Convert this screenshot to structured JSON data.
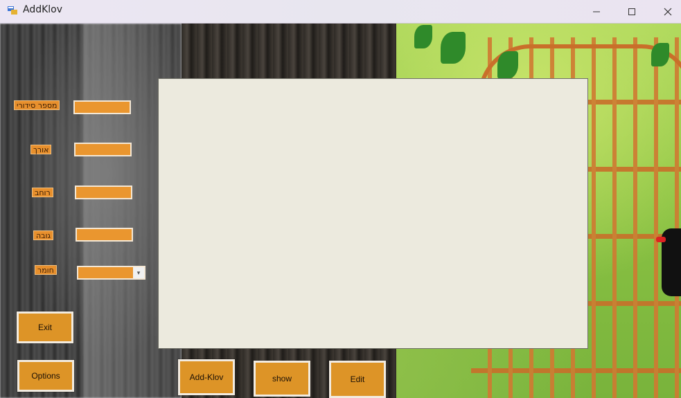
{
  "window": {
    "title": "AddKlov"
  },
  "form": {
    "fields": [
      {
        "label": "מספר סידורי",
        "value": ""
      },
      {
        "label": "אורך",
        "value": ""
      },
      {
        "label": "רוחב",
        "value": ""
      },
      {
        "label": "גובה",
        "value": ""
      }
    ],
    "material": {
      "label": "חומר",
      "selected": ""
    }
  },
  "buttons": {
    "exit": "Exit",
    "options": "Options",
    "add_klov": "Add-Klov",
    "show": "show",
    "edit": "Edit"
  },
  "colors": {
    "accent_orange": "#dd9427",
    "panel_bg": "#eceade"
  },
  "icons": {
    "app": "app-window-icon",
    "minimize": "minimize-icon",
    "maximize": "maximize-icon",
    "close": "close-icon",
    "dropdown": "chevron-down-icon"
  }
}
